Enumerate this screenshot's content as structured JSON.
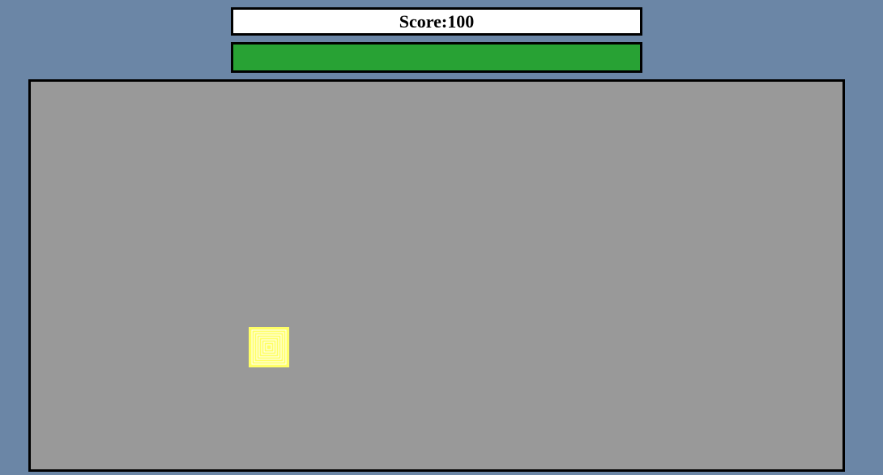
{
  "hud": {
    "score_label": "Score:100"
  },
  "progress": {
    "value": 1.0,
    "color": "#28a234"
  },
  "game_area": {
    "background_color": "#999999"
  },
  "player": {
    "icon": "concentric-square-icon",
    "color": "#ffff66"
  },
  "colors": {
    "page_background": "#6b86a6",
    "border": "#000000"
  }
}
